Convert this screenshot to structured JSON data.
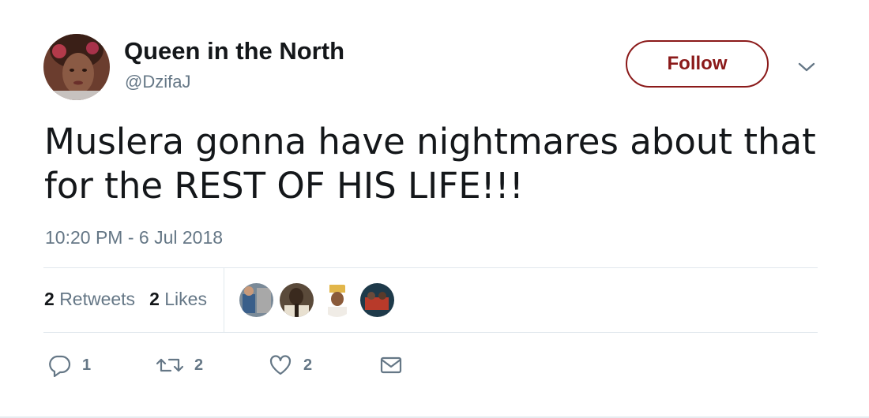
{
  "tweet": {
    "display_name": "Queen in the North",
    "handle": "@DzifaJ",
    "follow_label": "Follow",
    "text_line1": "Muslera gonna have nightmares about that",
    "text_line2": "for the REST OF HIS LIFE!!!",
    "timestamp": "10:20 PM - 6 Jul 2018"
  },
  "stats": {
    "retweets_count": "2",
    "retweets_label": "Retweets",
    "likes_count": "2",
    "likes_label": "Likes"
  },
  "actions": {
    "reply_count": "1",
    "retweet_count": "2",
    "like_count": "2"
  },
  "icons": {
    "caret": "chevron-down-icon",
    "reply": "reply-icon",
    "retweet": "retweet-icon",
    "like": "heart-icon",
    "dm": "envelope-icon"
  },
  "colors": {
    "follow_accent": "#8b1a1a",
    "muted_text": "#657786",
    "primary_text": "#14171a",
    "divider": "#e1e8ed"
  }
}
